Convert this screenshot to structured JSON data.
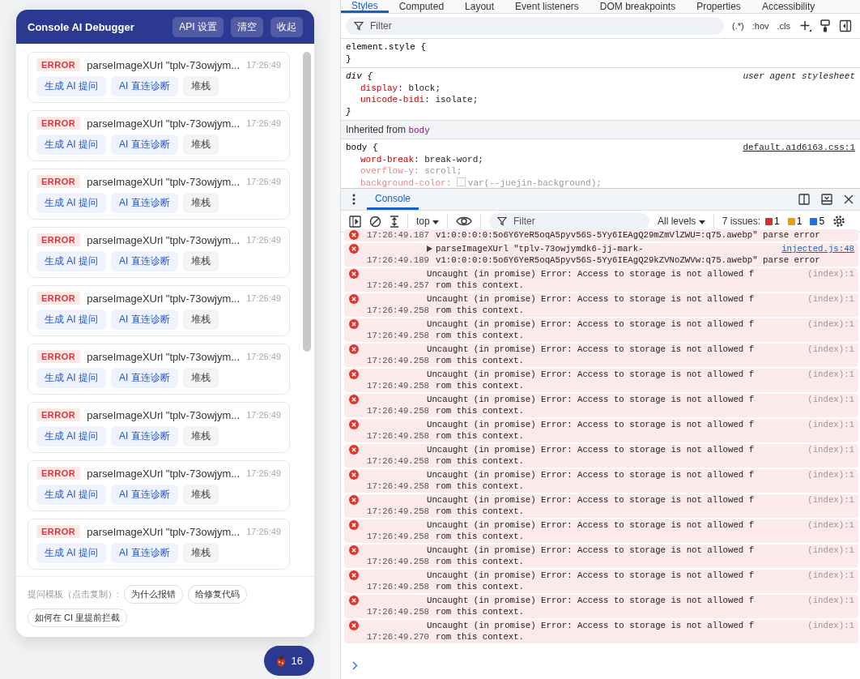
{
  "panel": {
    "title": "Console AI Debugger",
    "header_buttons": [
      "API 设置",
      "清空",
      "收起"
    ],
    "entries": [
      {
        "level": "ERROR",
        "message": "parseImageXUrl \"tplv-73owjym...",
        "time": "17:26:49",
        "actions": [
          {
            "label": "生成 AI 提问",
            "kind": "primary"
          },
          {
            "label": "AI 直连诊断",
            "kind": "primary"
          },
          {
            "label": "堆栈",
            "kind": "secondary"
          }
        ]
      },
      {
        "level": "ERROR",
        "message": "parseImageXUrl \"tplv-73owjym...",
        "time": "17:26:49",
        "actions": [
          {
            "label": "生成 AI 提问",
            "kind": "primary"
          },
          {
            "label": "AI 直连诊断",
            "kind": "primary"
          },
          {
            "label": "堆栈",
            "kind": "secondary"
          }
        ]
      },
      {
        "level": "ERROR",
        "message": "parseImageXUrl \"tplv-73owjym...",
        "time": "17:26:49",
        "actions": [
          {
            "label": "生成 AI 提问",
            "kind": "primary"
          },
          {
            "label": "AI 直连诊断",
            "kind": "primary"
          },
          {
            "label": "堆栈",
            "kind": "secondary"
          }
        ]
      },
      {
        "level": "ERROR",
        "message": "parseImageXUrl \"tplv-73owjym...",
        "time": "17:26:49",
        "actions": [
          {
            "label": "生成 AI 提问",
            "kind": "primary"
          },
          {
            "label": "AI 直连诊断",
            "kind": "primary"
          },
          {
            "label": "堆栈",
            "kind": "secondary"
          }
        ]
      },
      {
        "level": "ERROR",
        "message": "parseImageXUrl \"tplv-73owjym...",
        "time": "17:26:49",
        "actions": [
          {
            "label": "生成 AI 提问",
            "kind": "primary"
          },
          {
            "label": "AI 直连诊断",
            "kind": "primary"
          },
          {
            "label": "堆栈",
            "kind": "secondary"
          }
        ]
      },
      {
        "level": "ERROR",
        "message": "parseImageXUrl \"tplv-73owjym...",
        "time": "17:26:49",
        "actions": [
          {
            "label": "生成 AI 提问",
            "kind": "primary"
          },
          {
            "label": "AI 直连诊断",
            "kind": "primary"
          },
          {
            "label": "堆栈",
            "kind": "secondary"
          }
        ]
      },
      {
        "level": "ERROR",
        "message": "parseImageXUrl \"tplv-73owjym...",
        "time": "17:26:49",
        "actions": [
          {
            "label": "生成 AI 提问",
            "kind": "primary"
          },
          {
            "label": "AI 直连诊断",
            "kind": "primary"
          },
          {
            "label": "堆栈",
            "kind": "secondary"
          }
        ]
      },
      {
        "level": "ERROR",
        "message": "parseImageXUrl \"tplv-73owjym...",
        "time": "17:26:49",
        "actions": [
          {
            "label": "生成 AI 提问",
            "kind": "primary"
          },
          {
            "label": "AI 直连诊断",
            "kind": "primary"
          },
          {
            "label": "堆栈",
            "kind": "secondary"
          }
        ]
      },
      {
        "level": "ERROR",
        "message": "parseImageXUrl \"tplv-73owjym...",
        "time": "17:26:49",
        "actions": [
          {
            "label": "生成 AI 提问",
            "kind": "primary"
          },
          {
            "label": "AI 直连诊断",
            "kind": "primary"
          },
          {
            "label": "堆栈",
            "kind": "secondary"
          }
        ]
      }
    ],
    "templates": {
      "label": "提问模板（点击复制）:",
      "chips": [
        "为什么报错",
        "给修复代码",
        "如何在 CI 里提前拦截"
      ]
    }
  },
  "fab": {
    "count": "16"
  },
  "devtools": {
    "tabs": [
      {
        "label": "Styles",
        "selected": true
      },
      {
        "label": "Computed",
        "selected": false
      },
      {
        "label": "Layout",
        "selected": false
      },
      {
        "label": "Event listeners",
        "selected": false
      },
      {
        "label": "DOM breakpoints",
        "selected": false
      },
      {
        "label": "Properties",
        "selected": false
      },
      {
        "label": "Accessibility",
        "selected": false
      }
    ],
    "filter": {
      "placeholder": "Filter",
      "tools": [
        "(.*)",
        ":hov",
        ".cls"
      ]
    },
    "rules": [
      {
        "selector": "element.style {",
        "italic": false,
        "close": "}"
      },
      {
        "selector": "div {",
        "italic": true,
        "source": "user agent stylesheet",
        "source_link": false,
        "close": "}",
        "props": [
          {
            "name": "display",
            "value": ": block;",
            "inactive": false
          },
          {
            "name": "unicode-bidi",
            "value": ": isolate;",
            "inactive": false
          }
        ]
      }
    ],
    "inherited": {
      "label": "Inherited from ",
      "element": "body"
    },
    "body_rule": {
      "selector": "body {",
      "source": "default.a1d6163.css:1",
      "props": [
        {
          "name": "word-break",
          "value": ": break-word;",
          "inactive": false
        },
        {
          "name": "overflow-y",
          "value": ": scroll;",
          "inactive": true
        },
        {
          "name": "background-color",
          "value": ": ",
          "value2": "var(--juejin-background);",
          "inactive": true,
          "swatch": true
        }
      ]
    }
  },
  "console": {
    "tabs": [
      {
        "label": "Console",
        "selected": true
      }
    ],
    "context": "top",
    "filter_placeholder": "Filter",
    "levels": "All levels",
    "issues_label": "7 issues:",
    "issues": [
      {
        "kind": "error",
        "count": "1"
      },
      {
        "kind": "warning",
        "count": "1"
      },
      {
        "kind": "info",
        "count": "5"
      }
    ],
    "messages": [
      {
        "time": "17:26:49.187",
        "expandable": false,
        "lines": [
          "v1:0:0:0:0:5o6Y6YeR5oqA5pyv56S-5Yy6IEAgQ29mZmVlZWU=:q75.awebp\" parse error"
        ]
      },
      {
        "time": "17:26:49.189",
        "expandable": true,
        "lines": [
          "parseImageXUrl \"tplv-73owjymdk6-jj-mark-",
          "v1:0:0:0:0:5o6Y6YeR5oqA5pyv56S-5Yy6IEAgQ29kZVNoZWVw:q75.awebp\" parse error"
        ],
        "source": "injected.js:48",
        "source_link": true
      },
      {
        "time": "17:26:49.257",
        "expandable": false,
        "lines": [
          "Uncaught (in promise) Error: Access to storage is not allowed f",
          "rom this context."
        ],
        "source": "(index):1",
        "source_link": false
      },
      {
        "time": "17:26:49.258",
        "expandable": false,
        "lines": [
          "Uncaught (in promise) Error: Access to storage is not allowed f",
          "rom this context."
        ],
        "source": "(index):1",
        "source_link": false
      },
      {
        "time": "17:26:49.258",
        "expandable": false,
        "lines": [
          "Uncaught (in promise) Error: Access to storage is not allowed f",
          "rom this context."
        ],
        "source": "(index):1",
        "source_link": false
      },
      {
        "time": "17:26:49.258",
        "expandable": false,
        "lines": [
          "Uncaught (in promise) Error: Access to storage is not allowed f",
          "rom this context."
        ],
        "source": "(index):1",
        "source_link": false
      },
      {
        "time": "17:26:49.258",
        "expandable": false,
        "lines": [
          "Uncaught (in promise) Error: Access to storage is not allowed f",
          "rom this context."
        ],
        "source": "(index):1",
        "source_link": false
      },
      {
        "time": "17:26:49.258",
        "expandable": false,
        "lines": [
          "Uncaught (in promise) Error: Access to storage is not allowed f",
          "rom this context."
        ],
        "source": "(index):1",
        "source_link": false
      },
      {
        "time": "17:26:49.258",
        "expandable": false,
        "lines": [
          "Uncaught (in promise) Error: Access to storage is not allowed f",
          "rom this context."
        ],
        "source": "(index):1",
        "source_link": false
      },
      {
        "time": "17:26:49.258",
        "expandable": false,
        "lines": [
          "Uncaught (in promise) Error: Access to storage is not allowed f",
          "rom this context."
        ],
        "source": "(index):1",
        "source_link": false
      },
      {
        "time": "17:26:49.258",
        "expandable": false,
        "lines": [
          "Uncaught (in promise) Error: Access to storage is not allowed f",
          "rom this context."
        ],
        "source": "(index):1",
        "source_link": false
      },
      {
        "time": "17:26:49.258",
        "expandable": false,
        "lines": [
          "Uncaught (in promise) Error: Access to storage is not allowed f",
          "rom this context."
        ],
        "source": "(index):1",
        "source_link": false
      },
      {
        "time": "17:26:49.258",
        "expandable": false,
        "lines": [
          "Uncaught (in promise) Error: Access to storage is not allowed f",
          "rom this context."
        ],
        "source": "(index):1",
        "source_link": false
      },
      {
        "time": "17:26:49.258",
        "expandable": false,
        "lines": [
          "Uncaught (in promise) Error: Access to storage is not allowed f",
          "rom this context."
        ],
        "source": "(index):1",
        "source_link": false
      },
      {
        "time": "17:26:49.258",
        "expandable": false,
        "lines": [
          "Uncaught (in promise) Error: Access to storage is not allowed f",
          "rom this context."
        ],
        "source": "(index):1",
        "source_link": false
      },
      {
        "time": "17:26:49.258",
        "expandable": false,
        "lines": [
          "Uncaught (in promise) Error: Access to storage is not allowed f",
          "rom this context."
        ],
        "source": "(index):1",
        "source_link": false
      },
      {
        "time": "17:26:49.270",
        "expandable": false,
        "lines": [
          "Uncaught (in promise) Error: Access to storage is not allowed f",
          "rom this context."
        ],
        "source": "(index):1",
        "source_link": false
      }
    ]
  }
}
